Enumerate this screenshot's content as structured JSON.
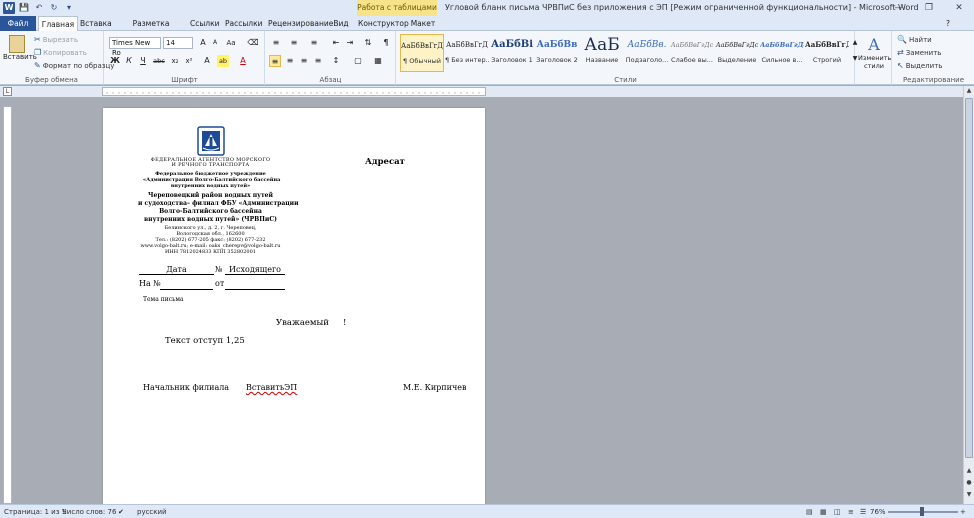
{
  "window": {
    "title": "Угловой бланк письма ЧРВПиС без приложения с ЭП [Режим ограниченной функциональности]  -  Microsoft Word",
    "tools_tab": "Работа с таблицами",
    "app_icon": "W"
  },
  "tabs": [
    "Файл",
    "Главная",
    "Вставка",
    "Разметка страницы",
    "Ссылки",
    "Рассылки",
    "Рецензирование",
    "Вид",
    "Конструктор",
    "Макет"
  ],
  "clipboard": {
    "paste": "Вставить",
    "cut": "Вырезать",
    "copy": "Копировать",
    "format_painter": "Формат по образцу",
    "label": "Буфер обмена"
  },
  "font": {
    "name": "Times New Ro",
    "size": "14",
    "label": "Шрифт",
    "bold": "Ж",
    "italic": "К",
    "underline": "Ч",
    "strike": "abc",
    "subscript": "x₂",
    "superscript": "x²",
    "grow": "A",
    "shrink": "A",
    "case": "Aa",
    "clear": "A",
    "highlight": "ab",
    "color": "A"
  },
  "paragraph": {
    "label": "Абзац"
  },
  "styles": {
    "label": "Стили",
    "items": [
      {
        "sample": "АаБбВвГгД",
        "name": "¶ Обычный"
      },
      {
        "sample": "АаБбВвГгД",
        "name": "¶ Без интер..."
      },
      {
        "sample": "АаБбВі",
        "name": "Заголовок 1"
      },
      {
        "sample": "АаБбВв",
        "name": "Заголовок 2"
      },
      {
        "sample": "АаБ",
        "name": "Название"
      },
      {
        "sample": "АаБбВв.",
        "name": "Подзаголо..."
      },
      {
        "sample": "АаБбВвГгДс",
        "name": "Слабое вы..."
      },
      {
        "sample": "АаБбВвГгДс",
        "name": "Выделение"
      },
      {
        "sample": "АаБбВвГгДс",
        "name": "Сильное в..."
      },
      {
        "sample": "АаБбВвГгД",
        "name": "Строгий"
      }
    ],
    "change": "Изменить стили"
  },
  "editing": {
    "label": "Редактирование",
    "find": "Найти",
    "replace": "Заменить",
    "select": "Выделить"
  },
  "document": {
    "agency_line1": "ФЕДЕРАЛЬНОЕ АГЕНТСТВО МОРСКОГО",
    "agency_line2": "И РЕЧНОГО ТРАНСПОРТА",
    "inst_line1": "Федеральное бюджетное учреждение",
    "inst_line2": "«Администрация Волго-Балтийского бассейна",
    "inst_line3": "внутренних водных путей»",
    "branch_line1": "Череповецкий район водных путей",
    "branch_line2": "и судоходства– филиал ФБУ «Администрации",
    "branch_line3": "Волго-Балтийского бассейна",
    "branch_line4": "внутренних водных путей» (ЧРВПиС)",
    "addr_line1": "Белинского ул., д. 2, г. Череповец,",
    "addr_line2": "Вологодская обл., 162600",
    "addr_line3": "Тел.: (8202) 677-205 факс: (8202) 677-232",
    "addr_line4": "www.volgo-balt.ru; e-mail: oaks_cherepv@volgo-balt.ru",
    "addr_line5": "ИНН 7812024833 КПП 352802001",
    "date_field": "Дата",
    "num_sign": "№",
    "outgoing_field": "Исходящего",
    "ref_prefix": "На №",
    "ref_from": "от",
    "subject": "Тема письма",
    "addressee": "Адресат",
    "greeting": "Уважаемый",
    "greeting_end": "!",
    "body": "Текст отступ 1,25",
    "signer_title": "Начальник филиала",
    "signature_placeholder": "ВставитьЭП",
    "signer_name": "М.Е. Кирпичев"
  },
  "status": {
    "page": "Страница: 1 из 1",
    "words": "Число слов: 76",
    "language": "русский",
    "zoom": "76%"
  }
}
